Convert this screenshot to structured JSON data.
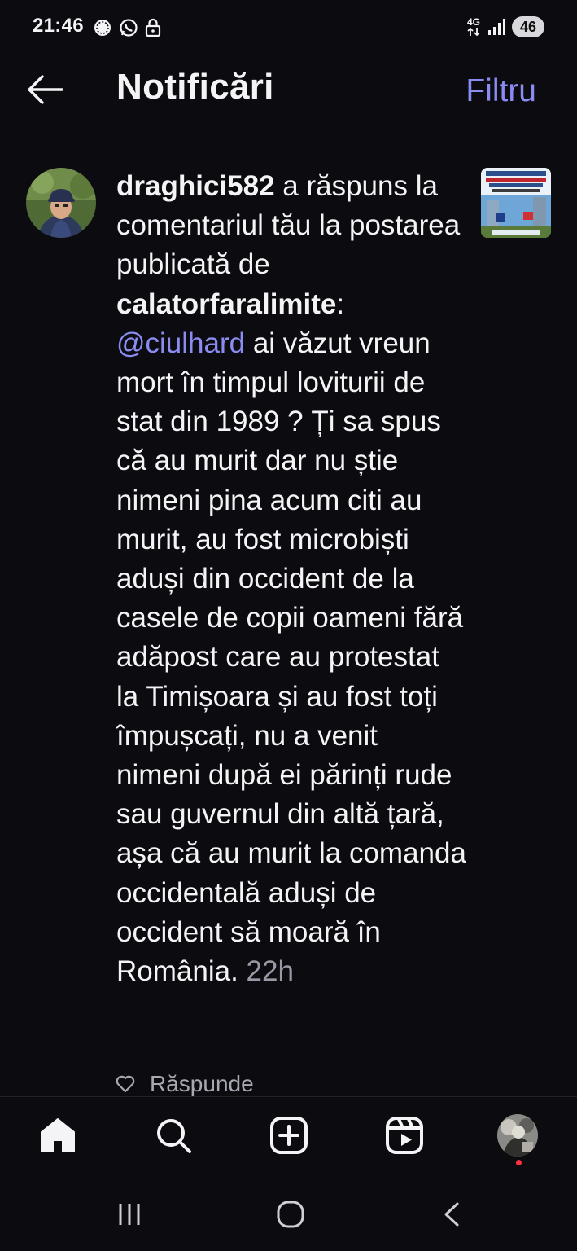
{
  "status_bar": {
    "time": "21:46",
    "network_label": "4G",
    "battery": "46",
    "left_icons": [
      "chat-bubble-icon",
      "whatsapp-icon",
      "lock-icon"
    ],
    "right_icons": [
      "data-arrows-icon",
      "signal-icon",
      "battery-icon"
    ]
  },
  "header": {
    "title": "Notificări",
    "filter_label": "Filtru"
  },
  "notification": {
    "username": "draghici582",
    "action_text": " a răspuns la comentariul tău la postarea publicată de ",
    "post_author": "calatorfaralimite",
    "colon": ":",
    "mention": "@ciulhard",
    "message": " ai văzut vreun mort în timpul  loviturii de stat din 1989 ? Ți  sa spus că au murit  dar nu știe nimeni pina acum citi au murit, au fost microbiști aduși din occident  de la casele de copii oameni fără adăpost care au protestat la Timișoara și au fost toți împușcați, nu a venit nimeni după ei părinți rude sau guvernul din altă țară, așa că au murit la comanda occidentală aduși de occident să moară în România. ",
    "time_ago": "22h",
    "reply_label": "Răspunde"
  },
  "bottom_nav": {
    "items": [
      "home-icon",
      "search-icon",
      "create-icon",
      "reels-icon",
      "profile-avatar"
    ]
  },
  "colors": {
    "background": "#0b0b10",
    "accent": "#8a8cf2",
    "text": "#f4f4f6",
    "muted": "#9a9aa6",
    "notification_dot": "#ff3040"
  }
}
